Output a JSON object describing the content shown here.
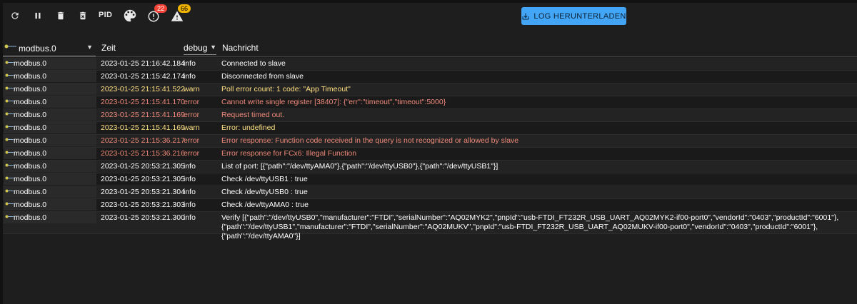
{
  "toolbar": {
    "pid_label": "PID",
    "error_badge": "22",
    "warning_badge": "66",
    "download_label": "LOG HERUNTERLADEN"
  },
  "header": {
    "source_value": "modbus.0",
    "time_label": "Zeit",
    "level_value": "debug",
    "message_label": "Nachricht"
  },
  "colors": {
    "accent": "#42a5f5",
    "info": "#ffffff",
    "warn": "#ffe082",
    "error": "#ef8a7a"
  },
  "rows": [
    {
      "source": "modbus.0",
      "time": "2023-01-25 21:16:42.184",
      "level": "info",
      "message": "Connected to slave"
    },
    {
      "source": "modbus.0",
      "time": "2023-01-25 21:15:42.174",
      "level": "info",
      "message": "Disconnected from slave"
    },
    {
      "source": "modbus.0",
      "time": "2023-01-25 21:15:41.522",
      "level": "warn",
      "message": "Poll error count: 1 code: \"App Timeout\""
    },
    {
      "source": "modbus.0",
      "time": "2023-01-25 21:15:41.170",
      "level": "error",
      "message": "Cannot write single register [38407]: {\"err\":\"timeout\",\"timeout\":5000}"
    },
    {
      "source": "modbus.0",
      "time": "2023-01-25 21:15:41.169",
      "level": "error",
      "message": "Request timed out."
    },
    {
      "source": "modbus.0",
      "time": "2023-01-25 21:15:41.169",
      "level": "warn",
      "message": "Error: undefined"
    },
    {
      "source": "modbus.0",
      "time": "2023-01-25 21:15:36.217",
      "level": "error",
      "message": "Error response: Function code received in the query is not recognized or allowed by slave"
    },
    {
      "source": "modbus.0",
      "time": "2023-01-25 21:15:36.216",
      "level": "error",
      "message": "Error response for FCx6: Illegal Function"
    },
    {
      "source": "modbus.0",
      "time": "2023-01-25 20:53:21.305",
      "level": "info",
      "message": "List of port: [{\"path\":\"/dev/ttyAMA0\"},{\"path\":\"/dev/ttyUSB0\"},{\"path\":\"/dev/ttyUSB1\"}]"
    },
    {
      "source": "modbus.0",
      "time": "2023-01-25 20:53:21.305",
      "level": "info",
      "message": "Check /dev/ttyUSB1 : true"
    },
    {
      "source": "modbus.0",
      "time": "2023-01-25 20:53:21.304",
      "level": "info",
      "message": "Check /dev/ttyUSB0 : true"
    },
    {
      "source": "modbus.0",
      "time": "2023-01-25 20:53:21.303",
      "level": "info",
      "message": "Check /dev/ttyAMA0 : true"
    },
    {
      "source": "modbus.0",
      "time": "2023-01-25 20:53:21.300",
      "level": "info",
      "message": "Verify [{\"path\":\"/dev/ttyUSB0\",\"manufacturer\":\"FTDI\",\"serialNumber\":\"AQ02MYK2\",\"pnpId\":\"usb-FTDI_FT232R_USB_UART_AQ02MYK2-if00-port0\",\"vendorId\":\"0403\",\"productId\":\"6001\"},{\"path\":\"/dev/ttyUSB1\",\"manufacturer\":\"FTDI\",\"serialNumber\":\"AQ02MUKV\",\"pnpId\":\"usb-FTDI_FT232R_USB_UART_AQ02MUKV-if00-port0\",\"vendorId\":\"0403\",\"productId\":\"6001\"},{\"path\":\"/dev/ttyAMA0\"}]"
    }
  ]
}
